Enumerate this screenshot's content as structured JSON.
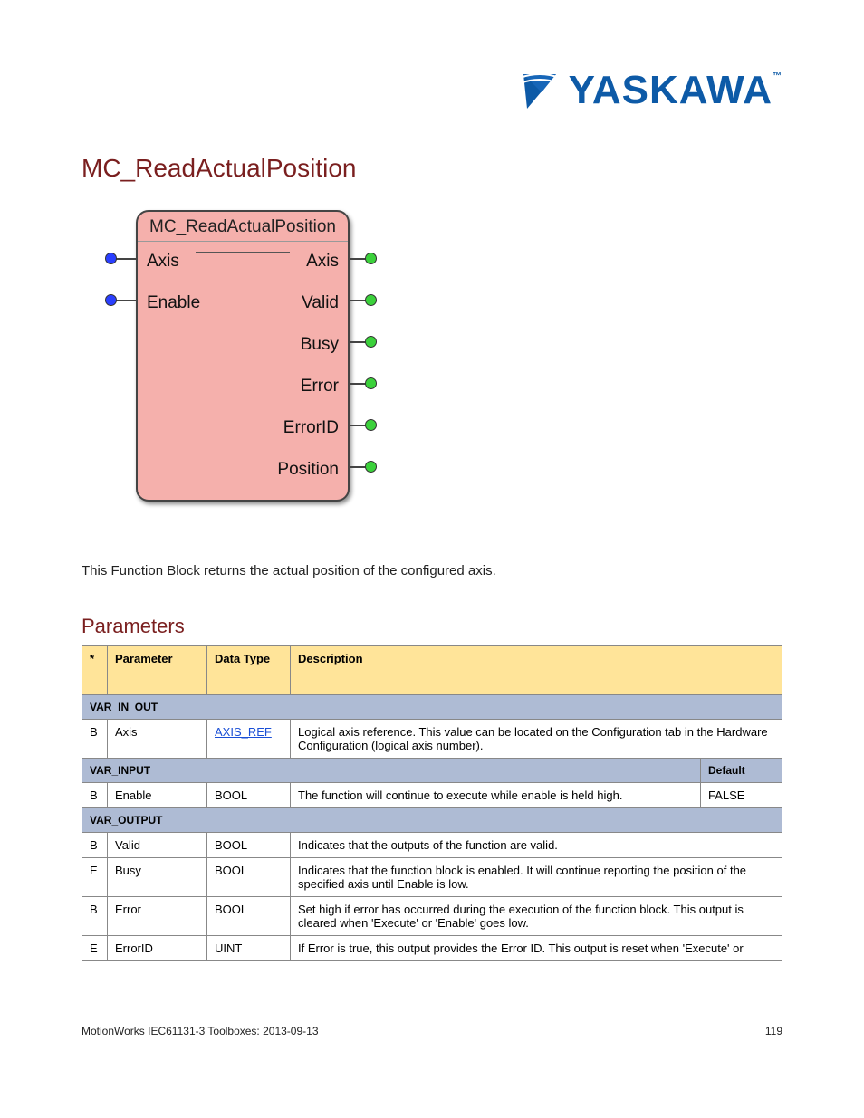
{
  "logo": {
    "text": "YASKAWA",
    "tm": "™"
  },
  "title": "MC_ReadActualPosition",
  "fb": {
    "header": "MC_ReadActualPosition",
    "inputs": [
      {
        "label": "Axis",
        "through": "Axis"
      },
      {
        "label": "Enable",
        "right": "Valid"
      }
    ],
    "outputs_only": [
      "Busy",
      "Error",
      "ErrorID",
      "Position"
    ]
  },
  "desc": "This Function Block returns the actual position of the configured axis.",
  "sections": {
    "params_title": "Parameters",
    "hdr": {
      "star": "*",
      "param": "Parameter",
      "type": "Data Type",
      "desc": "Description"
    },
    "varinout": "VAR_IN_OUT",
    "varin": "VAR_INPUT",
    "default": "Default",
    "varout": "VAR_OUTPUT"
  },
  "rows": {
    "axis": {
      "star": "B",
      "param": "Axis",
      "type": "AXIS_REF",
      "desc": "Logical axis reference.  This value can be located on the Configuration tab in the Hardware Configuration (logical axis number)."
    },
    "enable": {
      "star": "B",
      "param": "Enable",
      "type": "BOOL",
      "desc": "The function will continue to execute while enable is held high.",
      "default": "FALSE"
    },
    "valid": {
      "star": "B",
      "param": "Valid",
      "type": "BOOL",
      "desc": "Indicates that the outputs of the function are valid."
    },
    "busy": {
      "star": "E",
      "param": "Busy",
      "type": "BOOL",
      "desc": "Indicates that the function block is enabled. It will continue reporting the position of the specified axis until Enable is low."
    },
    "error": {
      "star": "B",
      "param": "Error",
      "type": "BOOL",
      "desc": "Set high if error has occurred during the execution of the function block.  This output is cleared when 'Execute' or 'Enable' goes low."
    },
    "errorid": {
      "star": "E",
      "param": "ErrorID",
      "type": "UINT",
      "desc": "If Error is true, this output provides the Error ID.  This output is reset when 'Execute' or"
    }
  },
  "footer": {
    "left": "MotionWorks IEC61131-3 Toolboxes: 2013-09-13",
    "right": "119"
  }
}
